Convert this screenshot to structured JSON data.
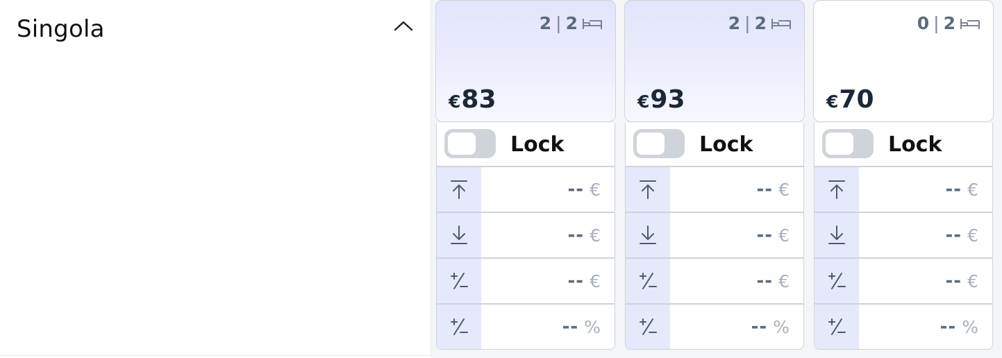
{
  "room": {
    "title": "Singola",
    "collapse_icon": "chevron-up-icon"
  },
  "days": [
    {
      "avail_booked": "2",
      "avail_sep": "|",
      "avail_total": "2",
      "bed_icon": "bed-icon",
      "currency": "€",
      "price": "83",
      "tinted": true,
      "lock_label": "Lock",
      "lock_on": false,
      "rules": [
        {
          "icon": "arrow-up-to-line-icon",
          "value": "--",
          "unit": "€"
        },
        {
          "icon": "arrow-down-to-line-icon",
          "value": "--",
          "unit": "€"
        },
        {
          "icon": "plus-minus-icon",
          "value": "--",
          "unit": "€"
        },
        {
          "icon": "plus-minus-icon",
          "value": "--",
          "unit": "%"
        }
      ]
    },
    {
      "avail_booked": "2",
      "avail_sep": "|",
      "avail_total": "2",
      "bed_icon": "bed-icon",
      "currency": "€",
      "price": "93",
      "tinted": true,
      "lock_label": "Lock",
      "lock_on": false,
      "rules": [
        {
          "icon": "arrow-up-to-line-icon",
          "value": "--",
          "unit": "€"
        },
        {
          "icon": "arrow-down-to-line-icon",
          "value": "--",
          "unit": "€"
        },
        {
          "icon": "plus-minus-icon",
          "value": "--",
          "unit": "€"
        },
        {
          "icon": "plus-minus-icon",
          "value": "--",
          "unit": "%"
        }
      ]
    },
    {
      "avail_booked": "0",
      "avail_sep": "|",
      "avail_total": "2",
      "bed_icon": "bed-icon",
      "currency": "€",
      "price": "70",
      "tinted": false,
      "lock_label": "Lock",
      "lock_on": false,
      "rules": [
        {
          "icon": "arrow-up-to-line-icon",
          "value": "--",
          "unit": "€"
        },
        {
          "icon": "arrow-down-to-line-icon",
          "value": "--",
          "unit": "€"
        },
        {
          "icon": "plus-minus-icon",
          "value": "--",
          "unit": "€"
        },
        {
          "icon": "plus-minus-icon",
          "value": "--",
          "unit": "%"
        }
      ]
    }
  ],
  "colors": {
    "tint": "#e2e4fc",
    "icon_cell": "#e6e8fb",
    "text_slate": "#5d6b7d",
    "unit_grey": "#a8b0bb",
    "price": "#1c2838"
  }
}
